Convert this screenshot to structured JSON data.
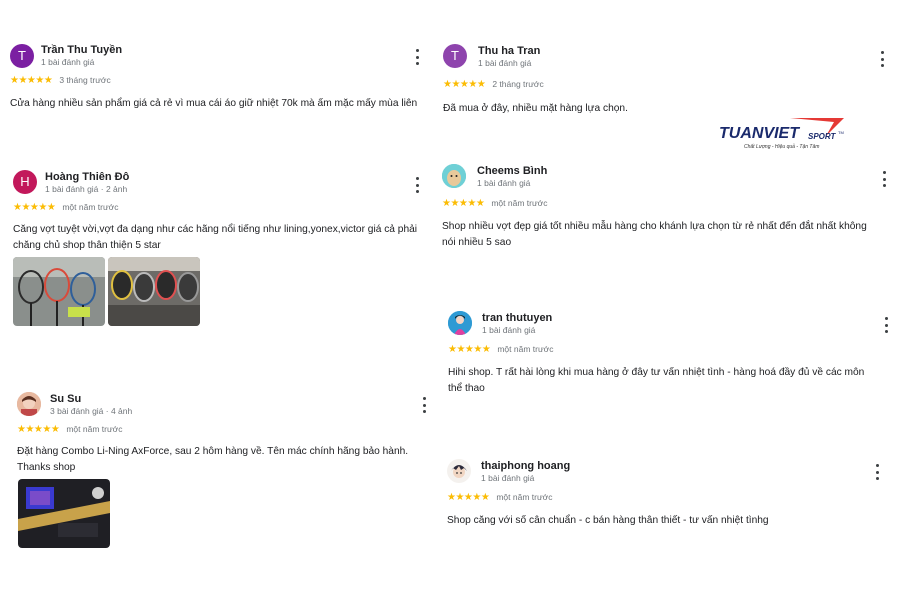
{
  "colors": {
    "star": "#fbbc04",
    "avatar_tran_thu_tuyen": "#7b1fa2",
    "avatar_thu_ha_tran": "#8e44ad",
    "avatar_hoang_thien_do": "#c2185b"
  },
  "logo": {
    "brand": "TUANVIET",
    "sport": "SPORT",
    "tm": "TM",
    "tagline": "Chất Lượng - Hiệu quả - Tận Tâm"
  },
  "reviews": [
    {
      "avatar_letter": "T",
      "name": "Trần Thu Tuyền",
      "meta": "1 bài đánh giá",
      "stars": "★★★★★",
      "when": "3 tháng trước",
      "text": "Cửa hàng nhiều sản phẩm giá cả rẻ vì mua cái áo giữ nhiệt 70k mà ấm mặc mấy mùa liên"
    },
    {
      "avatar_letter": "T",
      "name": "Thu ha Tran",
      "meta": "1 bài đánh giá",
      "stars": "★★★★★",
      "when": "2 tháng trước",
      "text": "Đã mua ở đây, nhiều mặt hàng lựa chọn."
    },
    {
      "avatar_letter": "H",
      "name": "Hoàng Thiên Đô",
      "meta": "1 bài đánh giá · 2 ảnh",
      "stars": "★★★★★",
      "when": "một năm trước",
      "text": "Căng vợt tuyệt vời,vợt đa dạng như các hãng nổi tiếng như lining,yonex,victor giá cả phải chăng chủ shop thân thiện 5 star"
    },
    {
      "name": "Cheems Bình",
      "meta": "1 bài đánh giá",
      "stars": "★★★★★",
      "when": "một năm trước",
      "text": "Shop nhiều vợt đẹp giá tốt nhiều mẫu hàng cho khánh lựa chọn từ rẻ nhất đến đắt nhất không nói nhiều 5 sao"
    },
    {
      "name": "Su Su",
      "meta": "3 bài đánh giá · 4 ảnh",
      "stars": "★★★★★",
      "when": "một năm trước",
      "text": "Đặt hàng Combo Li-Ning AxForce, sau 2 hôm hàng về. Tên mác chính hãng bảo hành. Thanks shop"
    },
    {
      "name": "tran thutuyen",
      "meta": "1 bài đánh giá",
      "stars": "★★★★★",
      "when": "một năm trước",
      "text": "Hihi shop. T rất hài lòng khi mua hàng ở đây tư vấn nhiệt tình - hàng hoá đầy đủ về các môn thể thao"
    },
    {
      "name": "thaiphong hoang",
      "meta": "1 bài đánh giá",
      "stars": "★★★★★",
      "when": "một năm trước",
      "text": "Shop căng với số cân chuẩn - c bán hàng thân thiết - tư vấn nhiệt tìnhg"
    }
  ]
}
